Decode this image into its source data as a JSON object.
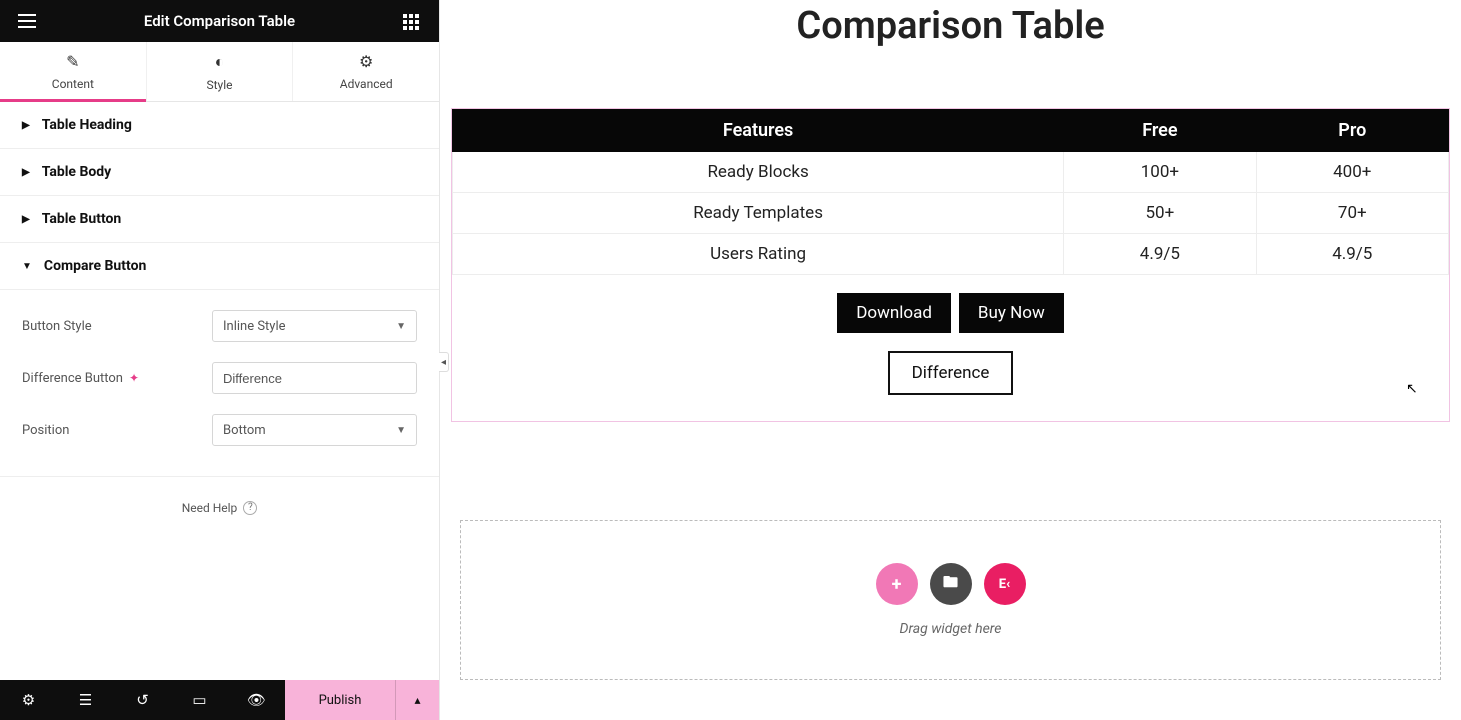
{
  "panel": {
    "title": "Edit Comparison Table",
    "tabs": [
      {
        "label": "Content",
        "icon": "✎",
        "active": true
      },
      {
        "label": "Style",
        "icon": "◐",
        "active": false
      },
      {
        "label": "Advanced",
        "icon": "⚙",
        "active": false
      }
    ],
    "sections": {
      "heading": "Table Heading",
      "body": "Table Body",
      "button": "Table Button",
      "compare": "Compare Button"
    },
    "controls": {
      "button_style_label": "Button Style",
      "button_style_value": "Inline Style",
      "diff_button_label": "Difference Button",
      "diff_button_value": "Difference",
      "position_label": "Position",
      "position_value": "Bottom"
    },
    "help": "Need Help",
    "publish": "Publish"
  },
  "preview": {
    "title": "Comparison Table",
    "headers": [
      "Features",
      "Free",
      "Pro"
    ],
    "rows": [
      [
        "Ready Blocks",
        "100+",
        "400+"
      ],
      [
        "Ready Templates",
        "50+",
        "70+"
      ],
      [
        "Users Rating",
        "4.9/5",
        "4.9/5"
      ]
    ],
    "buttons": {
      "download": "Download",
      "buy": "Buy Now",
      "diff": "Difference"
    },
    "drop_hint": "Drag widget here"
  }
}
